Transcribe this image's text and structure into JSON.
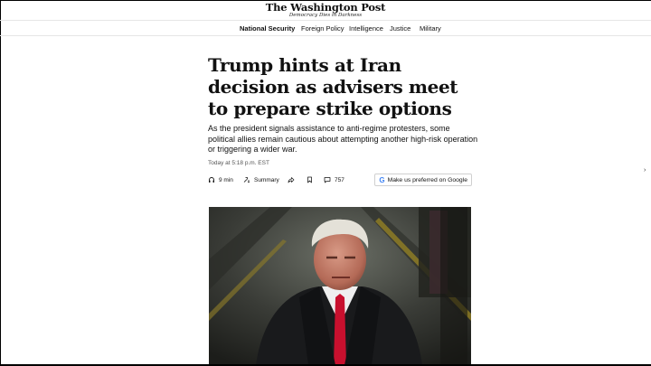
{
  "masthead": {
    "logo_text": "The Washington Post",
    "tagline": "Democracy Dies in Darkness"
  },
  "nav": {
    "items": [
      {
        "label": "National Security",
        "active": true
      },
      {
        "label": "Foreign Policy",
        "active": false
      },
      {
        "label": "Intelligence",
        "active": false
      },
      {
        "label": "Justice",
        "active": false
      },
      {
        "label": "Military",
        "active": false
      }
    ]
  },
  "article": {
    "headline": "Trump hints at Iran decision as advisers meet to prepare strike options",
    "dek": "As the president signals assistance to anti-regime protesters, some political allies remain cautious about attempting another high-risk operation or triggering a wider war.",
    "timestamp": "Today at 5:18 p.m. EST"
  },
  "tools": {
    "listen_label": "9 min",
    "summary_label": "Summary",
    "comments_count": "757",
    "google_label": "Make us preferred on Google",
    "google_mark": "G"
  },
  "icons": {
    "listen": "headphones-icon",
    "summary": "summary-icon",
    "share": "share-icon",
    "bookmark": "bookmark-icon",
    "comments": "comment-icon",
    "edge": "chevron-right-icon"
  },
  "colors": {
    "text": "#111111",
    "meta": "#555555",
    "tie": "#c8102e",
    "google_blue": "#4285f4"
  }
}
